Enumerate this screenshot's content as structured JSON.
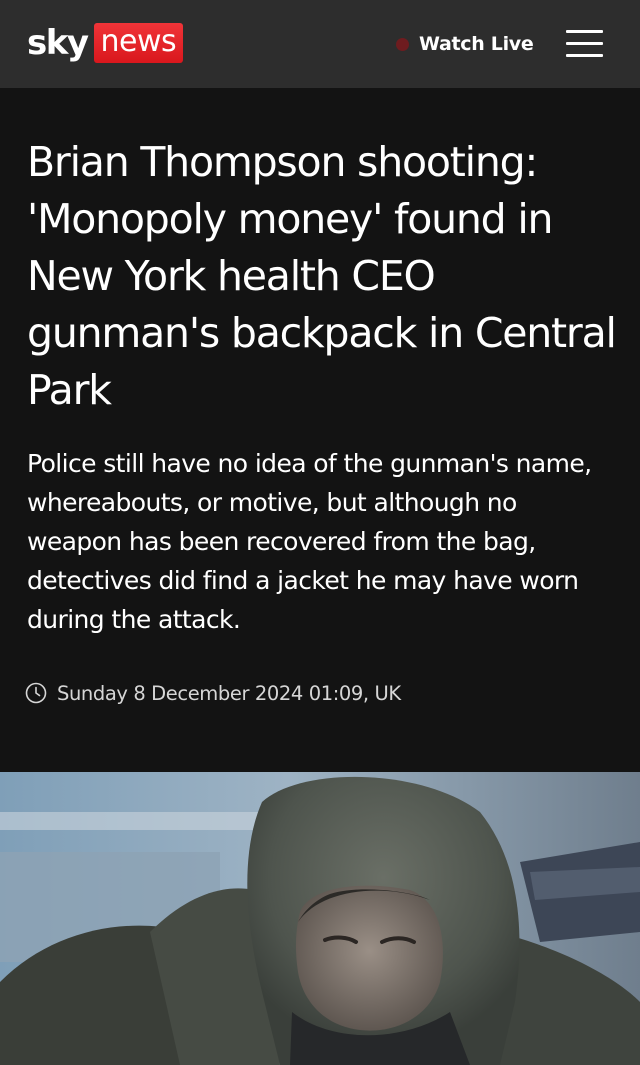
{
  "header": {
    "logo": {
      "sky": "sky",
      "news": "news"
    },
    "watch_live_label": "Watch Live",
    "menu_icon": "hamburger-menu-icon",
    "live_indicator_color": "#6e1c1f"
  },
  "article": {
    "headline": "Brian Thompson shooting: 'Monopoly money' found in New York health CEO gunman's backpack in Central Park",
    "standfirst": "Police still have no idea of the gunman's name, whereabouts, or motive, but although no weapon has been recovered from the bag, detectives did find a jacket he may have worn during the attack.",
    "timestamp": "Sunday 8 December 2024 01:09, UK",
    "timestamp_icon": "clock-icon"
  },
  "colors": {
    "background": "#131313",
    "header_background": "#2d2d2d",
    "brand_red": "#e4252a",
    "text": "#ffffff"
  }
}
